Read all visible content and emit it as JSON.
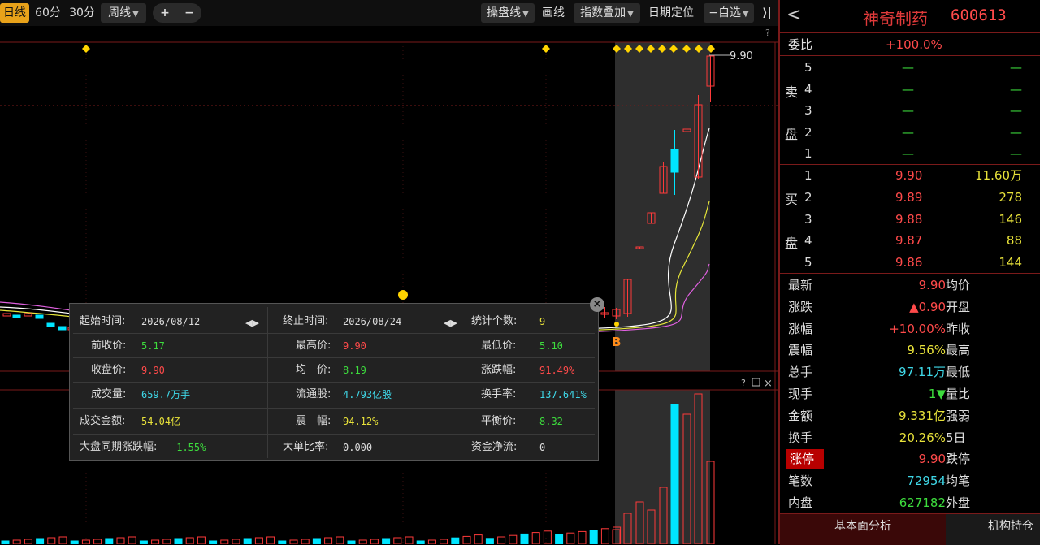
{
  "toolbar": {
    "period_tabs": [
      "日线",
      "60分",
      "30分",
      "周线"
    ],
    "zoom_in": "+",
    "zoom_out": "−",
    "right_buttons": [
      "操盘线",
      "画线",
      "指数叠加",
      "日期定位",
      "自选"
    ],
    "help": "?"
  },
  "chart": {
    "price_label": "9.90",
    "buy_marker": "B",
    "volume_help": "?",
    "colors": {
      "up": "#ff3a3a",
      "down": "#00e5ff",
      "ma1": "#ffffff",
      "ma2": "#e6e63a",
      "ma3": "#e060e0",
      "flag": "#ffd400"
    }
  },
  "stats": {
    "start_label": "起始时间:",
    "start_value": "2026/08/12",
    "end_label": "终止时间:",
    "end_value": "2026/08/24",
    "count_label": "统计个数:",
    "count_value": "9",
    "prev_close_label": "前收价:",
    "prev_close_value": "5.17",
    "high_label": "最高价:",
    "high_value": "9.90",
    "low_label": "最低价:",
    "low_value": "5.10",
    "close_label": "收盘价:",
    "close_value": "9.90",
    "avg_label": "均　价:",
    "avg_value": "8.19",
    "change_label": "涨跌幅:",
    "change_value": "91.49%",
    "volume_label": "成交量:",
    "volume_value": "659.7万手",
    "float_label": "流通股:",
    "float_value": "4.793亿股",
    "turnover_label": "换手率:",
    "turnover_value": "137.641%",
    "amount_label": "成交金额:",
    "amount_value": "54.04亿",
    "amplitude_label": "震　幅:",
    "amplitude_value": "94.12%",
    "balance_label": "平衡价:",
    "balance_value": "8.32",
    "market_label": "大盘同期涨跌幅:",
    "market_value": "-1.55%",
    "bigorder_label": "大单比率:",
    "bigorder_value": "0.000",
    "netflow_label": "资金净流:",
    "netflow_value": "0",
    "close_btn": "×"
  },
  "panel": {
    "back": "<",
    "name": "神奇制药",
    "code": "600613",
    "weibi_label": "委比",
    "weibi_value": "+100.0%",
    "sell_label": "卖盘",
    "buy_label": "买盘",
    "sell_rows": [
      {
        "level": "5",
        "price": "—",
        "vol": "—"
      },
      {
        "level": "4",
        "price": "—",
        "vol": "—"
      },
      {
        "level": "3",
        "price": "—",
        "vol": "—"
      },
      {
        "level": "2",
        "price": "—",
        "vol": "—"
      },
      {
        "level": "1",
        "price": "—",
        "vol": "—"
      }
    ],
    "buy_rows": [
      {
        "level": "1",
        "price": "9.90",
        "vol": "11.60万"
      },
      {
        "level": "2",
        "price": "9.89",
        "vol": "278"
      },
      {
        "level": "3",
        "price": "9.88",
        "vol": "146"
      },
      {
        "level": "4",
        "price": "9.87",
        "vol": "88"
      },
      {
        "level": "5",
        "price": "9.86",
        "vol": "144"
      }
    ],
    "quote": [
      {
        "label": "最新",
        "value": "9.90",
        "label2": "均价"
      },
      {
        "label": "涨跌",
        "value": "▲0.90",
        "label2": "开盘"
      },
      {
        "label": "涨幅",
        "value": "+10.00%",
        "label2": "昨收"
      },
      {
        "label": "震幅",
        "value": "9.56%",
        "label2": "最高"
      },
      {
        "label": "总手",
        "value": "97.11万",
        "label2": "最低"
      },
      {
        "label": "现手",
        "value": "1▼",
        "label2": "量比"
      },
      {
        "label": "金额",
        "value": "9.331亿",
        "label2": "强弱"
      },
      {
        "label": "换手",
        "value": "20.26%",
        "label2": "5日"
      },
      {
        "label": "涨停",
        "value": "9.90",
        "label2": "跌停"
      },
      {
        "label": "笔数",
        "value": "72954",
        "label2": "均笔"
      },
      {
        "label": "内盘",
        "value": "627182",
        "label2": "外盘"
      }
    ],
    "tabs": [
      "基本面分析",
      "机构持仓"
    ]
  }
}
